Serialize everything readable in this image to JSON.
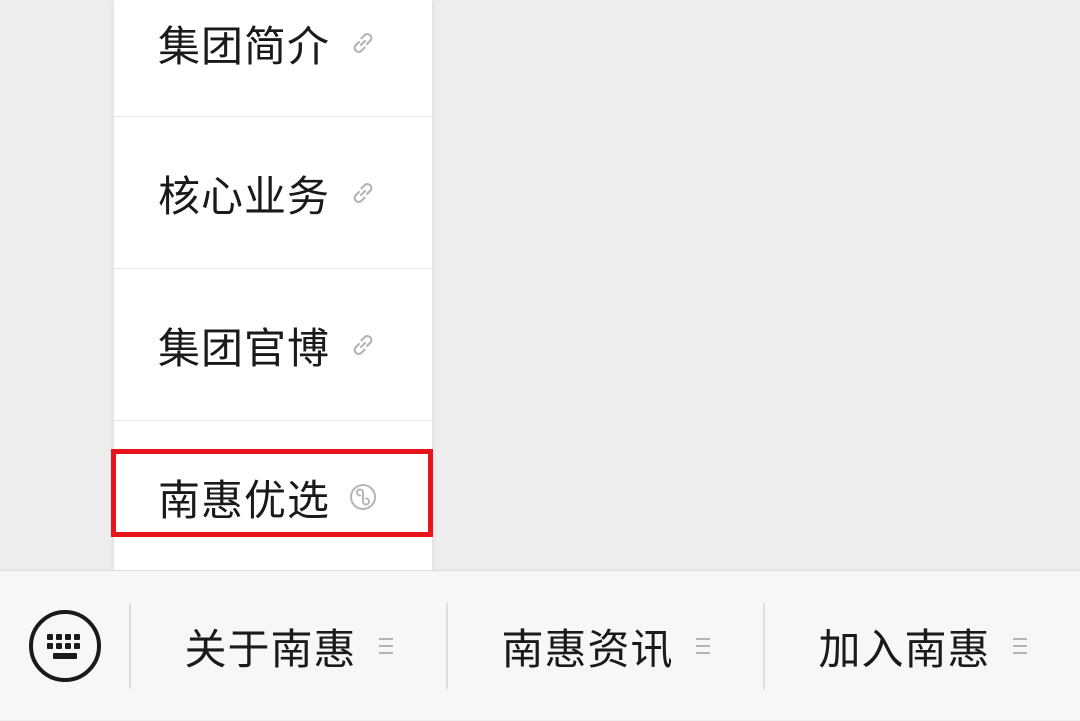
{
  "submenu": {
    "items": [
      {
        "label": "集团简介",
        "icon": "link-icon"
      },
      {
        "label": "核心业务",
        "icon": "link-icon"
      },
      {
        "label": "集团官博",
        "icon": "link-icon"
      },
      {
        "label": "南惠优选",
        "icon": "mini-program-icon",
        "highlighted": true
      }
    ]
  },
  "menubar": {
    "keyboard_icon": "keyboard-icon",
    "buttons": [
      {
        "label": "关于南惠",
        "icon": "menu-icon"
      },
      {
        "label": "南惠资讯",
        "icon": "menu-icon"
      },
      {
        "label": "加入南惠",
        "icon": "menu-icon"
      }
    ]
  },
  "colors": {
    "page_background": "#ededed",
    "menu_background": "#ffffff",
    "bar_background": "#f7f7f7",
    "highlight_border": "#e8141b",
    "icon_gray": "#b5b5b5",
    "text": "#1a1a1a"
  }
}
